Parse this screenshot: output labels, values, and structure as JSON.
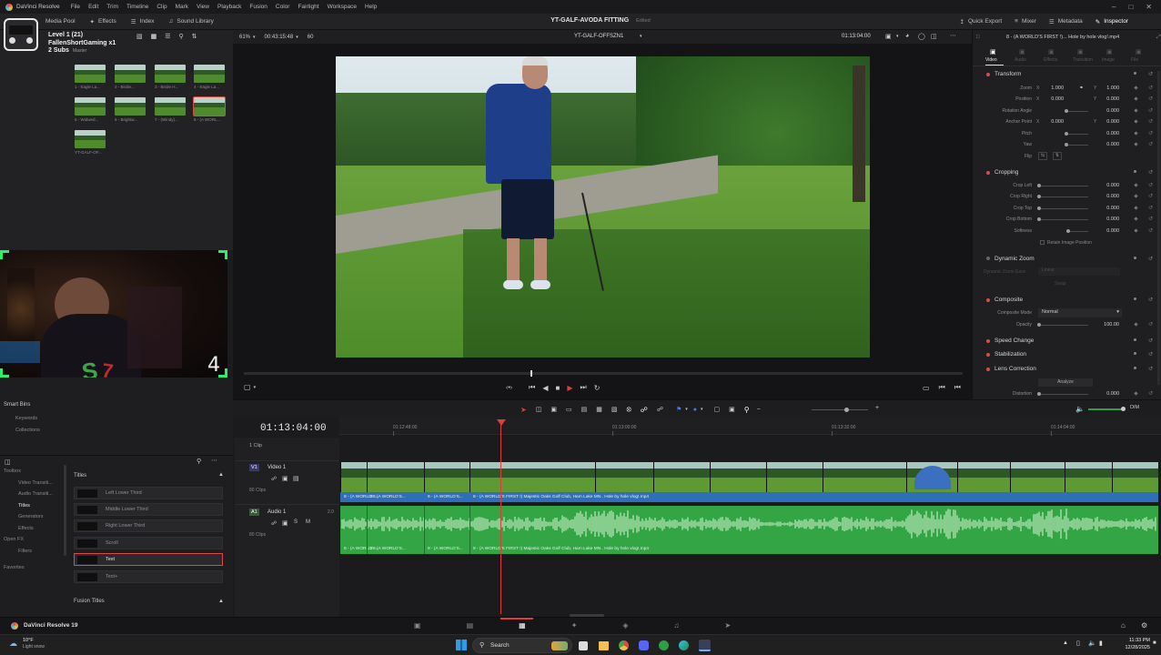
{
  "app": {
    "name": "DaVinci Resolve",
    "menu": [
      "File",
      "Edit",
      "Trim",
      "Timeline",
      "Clip",
      "Mark",
      "View",
      "Playback",
      "Fusion",
      "Color",
      "Fairlight",
      "Workspace",
      "Help"
    ],
    "project_title": "YT-GALF-AVODA FITTING",
    "project_status": "Edited"
  },
  "toolbar": {
    "media_pool": "Media Pool",
    "effects": "Effects",
    "index": "Index",
    "sound_library": "Sound Library",
    "quick_export": "Quick Export",
    "mixer": "Mixer",
    "metadata": "Metadata",
    "inspector": "Inspector"
  },
  "mediapool": {
    "bin_label": "Master",
    "thumbnails": [
      "1 - Eagle La...",
      "2 - Birdie...",
      "3 - Birdie H...",
      "4 - Eagle La...",
      "5 - Widwed...",
      "6 - Brightw...",
      "7 - (Windy)...",
      "8 - (A WORL...",
      "YT-GALF-OF..."
    ]
  },
  "overlay": {
    "level": "Level 1 (21)",
    "channel": "FallenShortGaming x1",
    "subs": "2 Subs",
    "counter": "4"
  },
  "smart_bins": {
    "title": "Smart Bins",
    "items": [
      "Keywords",
      "Collections"
    ]
  },
  "effects": {
    "categories": [
      "Toolbox",
      "Video Transiti...",
      "Audio Transiti...",
      "Titles",
      "Generators",
      "Effects",
      "Open FX",
      "Filters"
    ],
    "section_titles": "Titles",
    "items": [
      "Left Lower Third",
      "Middle Lower Third",
      "Right Lower Third",
      "Scroll",
      "Text",
      "Text+"
    ],
    "fusion_titles": "Fusion Titles",
    "favorites": "Favorites"
  },
  "viewer": {
    "zoom": "61%",
    "source_timecode": "00:43:15:48",
    "frame_rate": "60",
    "timeline_name": "YT-GALF-OFFSZN1",
    "record_timecode": "01:13:04:00",
    "playhead_fraction": 0.4
  },
  "inspector": {
    "clip_title": "8 - (A WORLD'S FIRST !)... Hole by hole vlog!.mp4",
    "tabs": [
      "Video",
      "Audio",
      "Effects",
      "Transition",
      "Image",
      "File"
    ],
    "transform": {
      "title": "Transform",
      "zoom_label": "Zoom",
      "zoom_x": "1.000",
      "zoom_y": "1.000",
      "position_label": "Position",
      "position_x": "0.000",
      "position_y": "0.000",
      "rotation_label": "Rotation Angle",
      "rotation": "0.000",
      "anchor_label": "Anchor Point",
      "anchor_x": "0.000",
      "anchor_y": "0.000",
      "pitch_label": "Pitch",
      "pitch": "0.000",
      "yaw_label": "Yaw",
      "yaw": "0.000",
      "flip_label": "Flip"
    },
    "cropping": {
      "title": "Cropping",
      "left_label": "Crop Left",
      "left": "0.000",
      "right_label": "Crop Right",
      "right": "0.000",
      "top_label": "Crop Top",
      "top": "0.000",
      "bottom_label": "Crop Bottom",
      "bottom": "0.000",
      "softness_label": "Softness",
      "softness": "0.000",
      "retain_label": "Retain Image Position"
    },
    "dynamic_zoom": {
      "title": "Dynamic Zoom",
      "ease_label": "Dynamic Zoom Ease",
      "ease_value": "Linear",
      "swap": "Swap"
    },
    "composite": {
      "title": "Composite",
      "mode_label": "Composite Mode",
      "mode": "Normal",
      "opacity_label": "Opacity",
      "opacity": "100.00"
    },
    "speed_change": "Speed Change",
    "stabilization": "Stabilization",
    "lens_correction": {
      "title": "Lens Correction",
      "analyze": "Analyze",
      "distortion_label": "Distortion",
      "distortion": "0.000"
    }
  },
  "timeline": {
    "timecode": "01:13:04:00",
    "ruler": [
      "01:12:48:00",
      "01:13:00:00",
      "01:13:32:00",
      "01:14:04:00"
    ],
    "clip_count": "1 Clip",
    "video_track": {
      "id": "V1",
      "name": "Video 1",
      "clips": "80 Clips"
    },
    "audio_track": {
      "id": "A1",
      "name": "Audio 1",
      "level": "2.0",
      "clips": "80 Clips"
    },
    "clip_label_long": "8 - (A WORLD'S FIRST !) Majestic Oaks Golf Club, Ham Lake MN.. Hole by hole vlog!.mp4",
    "clip_label_short": "8 - (A WORLD'S..."
  },
  "pagebar": {
    "version": "DaVinci Resolve 19"
  },
  "taskbar": {
    "weather_temp": "10°F",
    "weather_desc": "Light snow",
    "search_placeholder": "Search",
    "time": "11:33 PM",
    "date": "12/28/2025"
  }
}
